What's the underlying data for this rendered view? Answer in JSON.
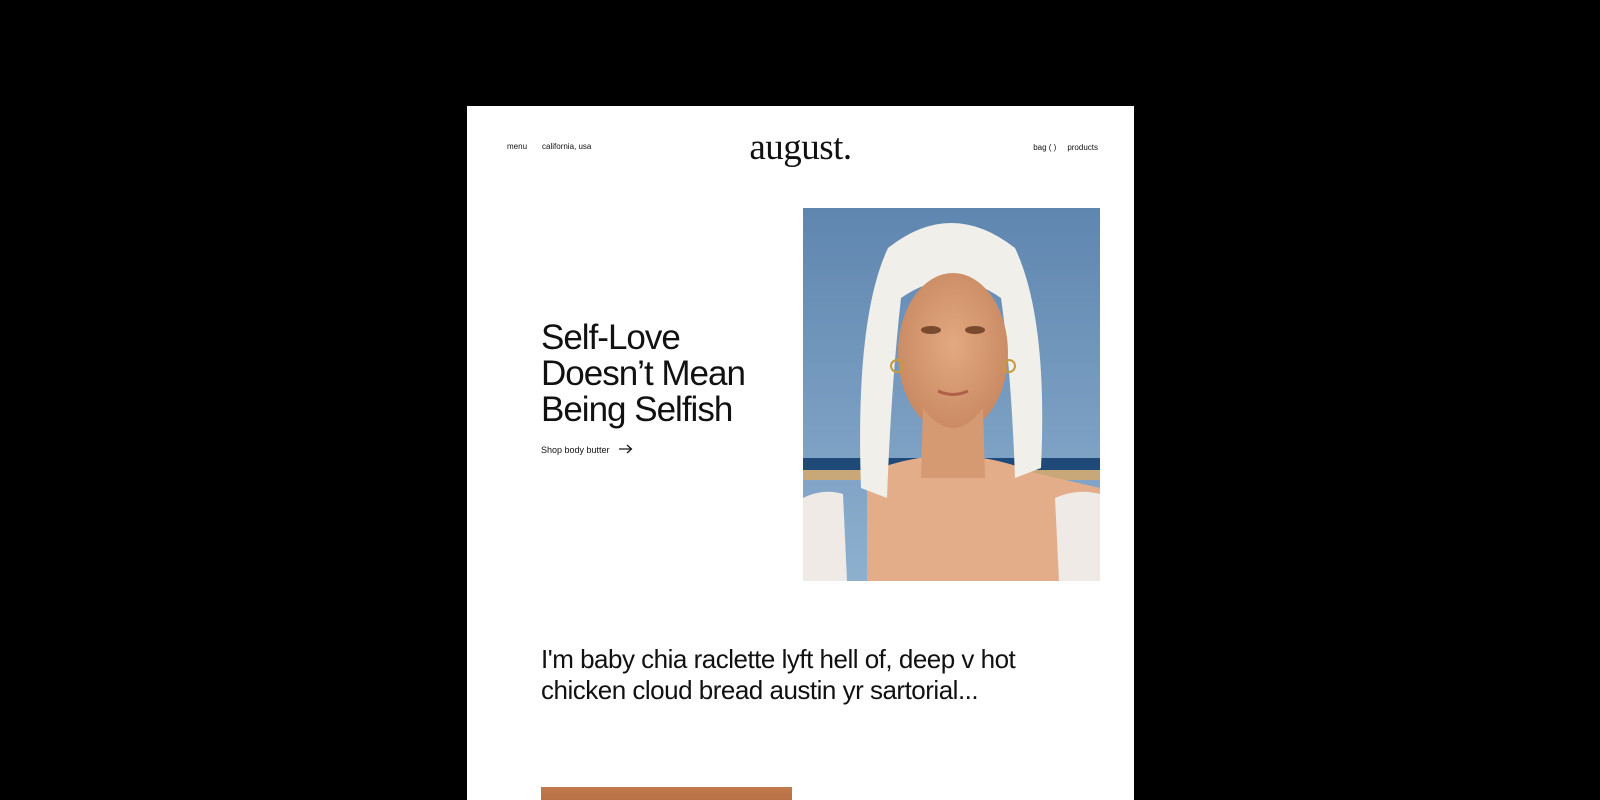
{
  "nav": {
    "menu_label": "menu",
    "location_label": "california, usa",
    "bag_label": "bag (  )",
    "products_label": "products"
  },
  "brand": {
    "logo_text": "august."
  },
  "hero": {
    "headline": "Self-Love Doesn’t Mean Being Selfish",
    "cta_label": "Shop body butter",
    "cta_icon": "arrow-right-icon"
  },
  "intro": {
    "text": "I'm baby chia raclette lyft hell of, deep v hot chicken cloud bread austin yr sartorial..."
  },
  "colors": {
    "background": "#000000",
    "page": "#ffffff",
    "text": "#111111"
  }
}
